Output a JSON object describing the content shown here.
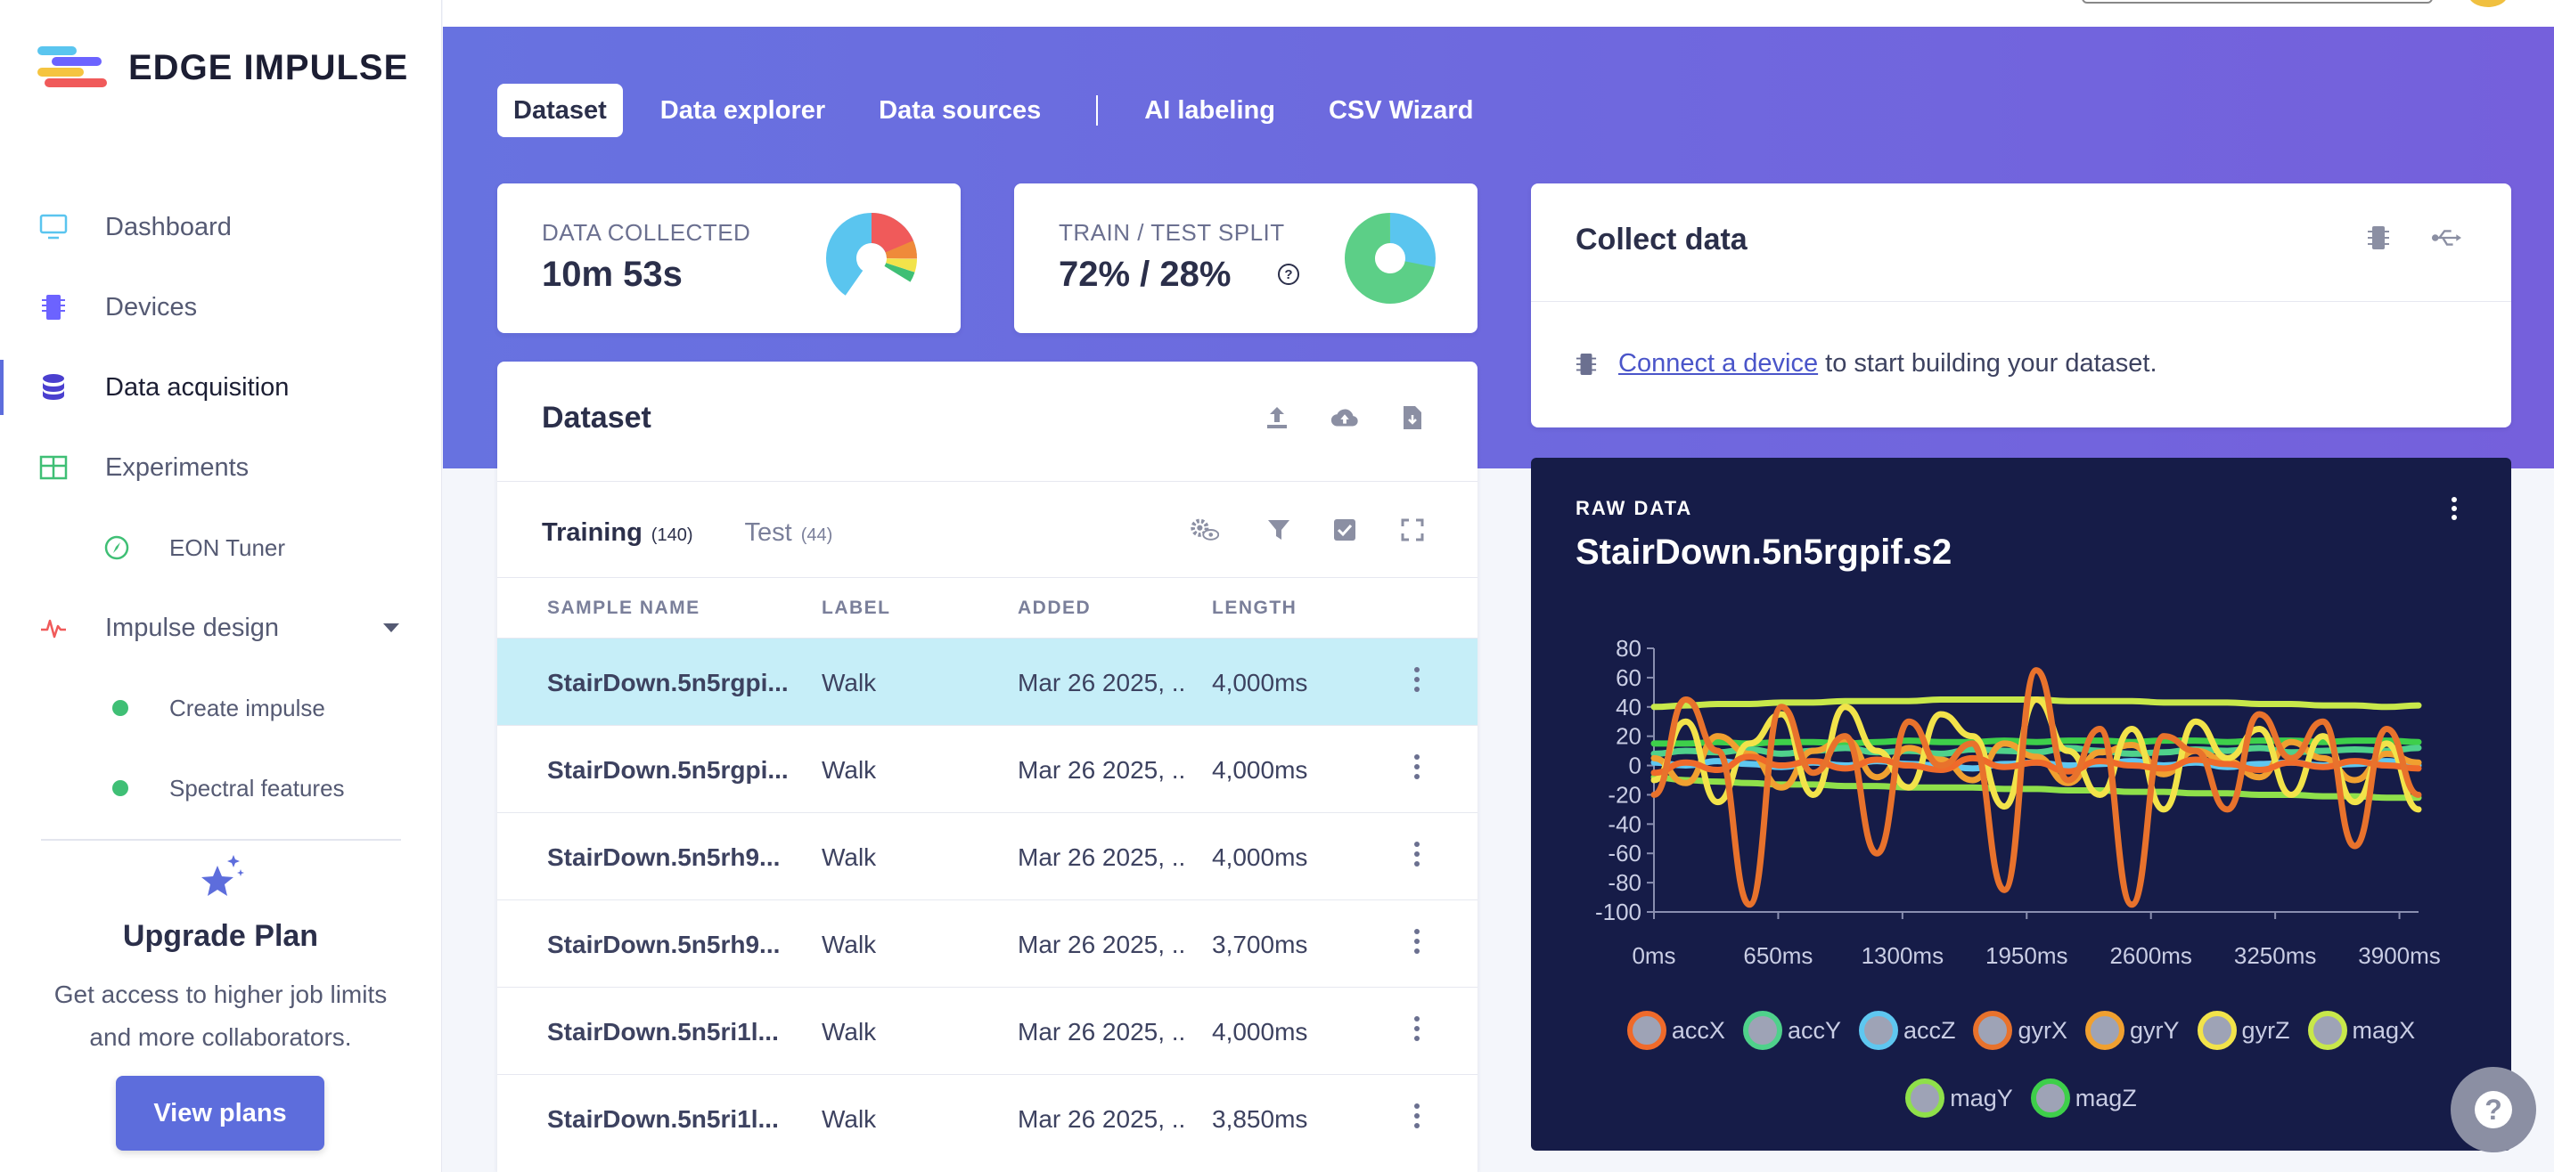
{
  "app": {
    "name": "EDGE IMPULSE"
  },
  "sidebar": {
    "items": [
      {
        "label": "Dashboard",
        "icon": "monitor-icon"
      },
      {
        "label": "Devices",
        "icon": "chip-icon"
      },
      {
        "label": "Data acquisition",
        "icon": "database-icon",
        "active": true
      },
      {
        "label": "Experiments",
        "icon": "table-icon"
      },
      {
        "label": "EON Tuner",
        "icon": "compass-icon"
      },
      {
        "label": "Impulse design",
        "icon": "pulse-icon"
      },
      {
        "label": "Create impulse",
        "icon": "green-dot"
      },
      {
        "label": "Spectral features",
        "icon": "green-dot"
      }
    ],
    "upgrade": {
      "title": "Upgrade Plan",
      "desc_line1": "Get access to higher job limits",
      "desc_line2": "and more collaborators.",
      "button": "View plans"
    }
  },
  "tabs": [
    "Dataset",
    "Data explorer",
    "Data sources",
    "AI labeling",
    "CSV Wizard"
  ],
  "stats": {
    "collected_label": "DATA COLLECTED",
    "collected_value": "10m 53s",
    "split_label": "TRAIN / TEST SPLIT",
    "split_value": "72% / 28%",
    "split_help": "?"
  },
  "collect": {
    "title": "Collect data",
    "link": "Connect a device",
    "text": " to start building your dataset."
  },
  "dataset": {
    "title": "Dataset",
    "training_label": "Training",
    "training_count": "(140)",
    "test_label": "Test",
    "test_count": "(44)",
    "columns": [
      "SAMPLE NAME",
      "LABEL",
      "ADDED",
      "LENGTH"
    ],
    "rows": [
      {
        "name": "StairDown.5n5rgpi...",
        "label": "Walk",
        "added": "Mar 26 2025, ...",
        "length": "4,000ms"
      },
      {
        "name": "StairDown.5n5rgpi...",
        "label": "Walk",
        "added": "Mar 26 2025, ...",
        "length": "4,000ms"
      },
      {
        "name": "StairDown.5n5rh9...",
        "label": "Walk",
        "added": "Mar 26 2025, ...",
        "length": "4,000ms"
      },
      {
        "name": "StairDown.5n5rh9...",
        "label": "Walk",
        "added": "Mar 26 2025, ...",
        "length": "3,700ms"
      },
      {
        "name": "StairDown.5n5ri1l...",
        "label": "Walk",
        "added": "Mar 26 2025, ...",
        "length": "4,000ms"
      },
      {
        "name": "StairDown.5n5ri1l...",
        "label": "Walk",
        "added": "Mar 26 2025, ...",
        "length": "3,850ms"
      }
    ]
  },
  "raw": {
    "label": "RAW DATA",
    "title": "StairDown.5n5rgpif.s2"
  },
  "chart_data": {
    "type": "line",
    "title": "StairDown.5n5rgpif.s2",
    "x_ticks": [
      "0ms",
      "650ms",
      "1300ms",
      "1950ms",
      "2600ms",
      "3250ms",
      "3900ms"
    ],
    "y_ticks": [
      80,
      60,
      40,
      20,
      0,
      -20,
      -40,
      -60,
      -80,
      -100
    ],
    "xlim": [
      0,
      4000
    ],
    "ylim": [
      -100,
      80
    ],
    "grid": false,
    "legend": "bottom",
    "series": [
      {
        "name": "accX",
        "color": "#ef6a2a",
        "values": [
          -5,
          2,
          -3,
          6,
          0,
          3,
          -2,
          4,
          0,
          -3,
          5,
          -1,
          2,
          -4,
          3,
          0,
          -2,
          4,
          1,
          -3,
          2,
          -1,
          3,
          0,
          -2
        ]
      },
      {
        "name": "accY",
        "color": "#4fd18b",
        "values": [
          8,
          10,
          9,
          11,
          8,
          10,
          12,
          9,
          10,
          8,
          11,
          10,
          9,
          12,
          10,
          8,
          9,
          11,
          10,
          12,
          9,
          10,
          11,
          10,
          12
        ]
      },
      {
        "name": "accZ",
        "color": "#5fc7f0",
        "values": [
          2,
          0,
          3,
          1,
          -1,
          2,
          0,
          3,
          1,
          0,
          -2,
          1,
          2,
          0,
          1,
          3,
          0,
          2,
          -1,
          1,
          2,
          0,
          1,
          3,
          0
        ]
      },
      {
        "name": "gyrX",
        "color": "#e8722c",
        "values": [
          -20,
          45,
          10,
          -95,
          40,
          -5,
          20,
          -60,
          30,
          0,
          15,
          -85,
          65,
          -10,
          25,
          -95,
          20,
          10,
          -30,
          35,
          5,
          30,
          -55,
          25,
          -20
        ]
      },
      {
        "name": "gyrY",
        "color": "#f0a030",
        "values": [
          5,
          -12,
          20,
          8,
          -15,
          10,
          18,
          -8,
          12,
          4,
          -10,
          15,
          6,
          -12,
          9,
          14,
          -6,
          10,
          3,
          -8,
          16,
          5,
          -10,
          8,
          2
        ]
      },
      {
        "name": "gyrZ",
        "color": "#f2e34a",
        "values": [
          -10,
          30,
          -25,
          15,
          35,
          -20,
          40,
          10,
          -15,
          35,
          20,
          -28,
          45,
          10,
          -20,
          25,
          -30,
          30,
          5,
          25,
          -20,
          20,
          -25,
          15,
          -30
        ]
      },
      {
        "name": "magX",
        "color": "#c8e84a",
        "values": [
          40,
          41,
          42,
          42,
          43,
          43,
          44,
          44,
          44,
          45,
          45,
          45,
          45,
          44,
          44,
          44,
          43,
          43,
          43,
          42,
          42,
          41,
          41,
          40,
          41
        ]
      },
      {
        "name": "magY",
        "color": "#8fe04a",
        "values": [
          -8,
          -10,
          -11,
          -12,
          -13,
          -13,
          -14,
          -14,
          -15,
          -15,
          -15,
          -16,
          -16,
          -17,
          -17,
          -18,
          -18,
          -19,
          -19,
          -20,
          -20,
          -21,
          -21,
          -22,
          -22
        ]
      },
      {
        "name": "magZ",
        "color": "#3ecf4a",
        "values": [
          15,
          15,
          16,
          15,
          16,
          16,
          15,
          16,
          17,
          16,
          16,
          17,
          16,
          17,
          17,
          16,
          17,
          17,
          16,
          17,
          17,
          16,
          17,
          17,
          16
        ]
      }
    ]
  },
  "help_fab": "?"
}
